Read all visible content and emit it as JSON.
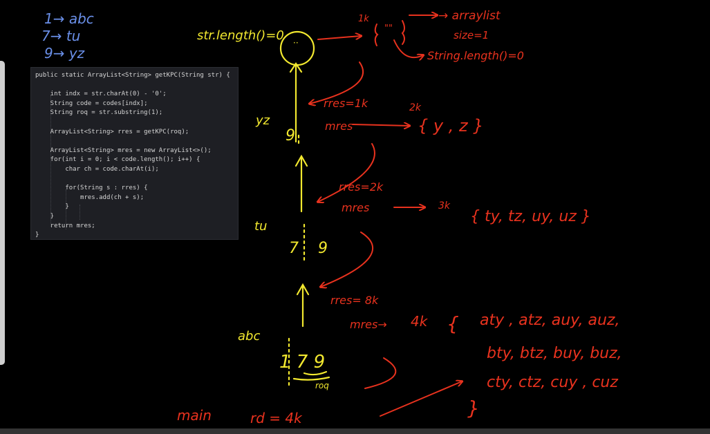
{
  "code": {
    "lines": [
      "public static ArrayList<String> getKPC(String str) {",
      "",
      "    int indx = str.charAt(0) - '0';",
      "    String code = codes[indx];",
      "    String roq = str.substring(1);",
      "",
      "    ArrayList<String> rres = getKPC(roq);",
      "",
      "    ArrayList<String> mres = new ArrayList<>();",
      "    for(int i = 0; i < code.length(); i++) {",
      "        char ch = code.charAt(i);",
      "",
      "        for(String s : rres) {",
      "            mres.add(ch + s);",
      "        }",
      "    }",
      "    return mres;",
      "}"
    ]
  },
  "colors": {
    "blue_ink": "#6a8fe8",
    "yellow_ink": "#f2e82f",
    "red_ink": "#e8321e",
    "panel_bg": "#1e1f24",
    "code_text": "#d6d6d6",
    "code_keyword": "#c27ee6"
  },
  "notes": {
    "map1": "1→  abc",
    "map2": "7→  tu",
    "map3": "9→  yz",
    "base_cond": "str.length()=0",
    "size_1k": "1k",
    "arraylist": "→ arraylist",
    "size1": "size=1",
    "str_len0": "String.length()=0",
    "rres_1k": "rres=1k",
    "label_2k": "2k",
    "mres_1": "mres",
    "yz_set": "{ y , z }",
    "yz_left": "yz",
    "digit_9_a": "9",
    "rres_2k": "rres=2k",
    "mres_2": "mres",
    "label_3k": "3k",
    "tu_set": "{ ty, tz, uy, uz }",
    "tu_left": "tu",
    "digit_7_a": "7",
    "digit_9_b": "9",
    "rres_8k": "rres= 8k",
    "mres_3": "mres→",
    "label_4k": "4k",
    "row1": "aty , atz,  auy,  auz,",
    "row2": "bty, btz,  buy,  buz,",
    "row3": "cty, ctz,  cuy  ,  cuz",
    "close_brace": "}",
    "abc_left": "abc",
    "digits_179": "1  7 9",
    "roq": "roq",
    "main": "main",
    "rd_4k": "rd = 4k"
  }
}
